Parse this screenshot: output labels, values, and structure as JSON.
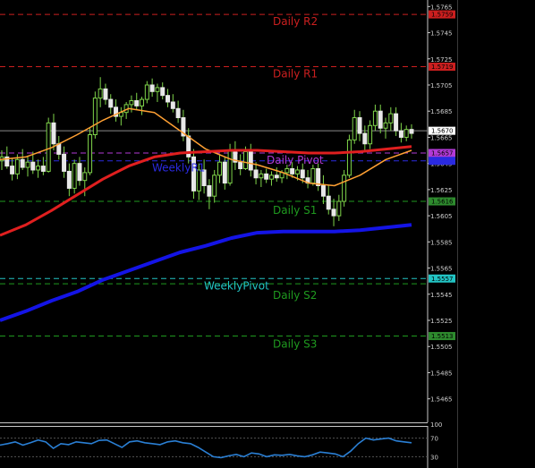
{
  "chart_data": {
    "type": "candlestick",
    "background": "#000000",
    "price_axis": {
      "ylim": [
        1.5447,
        1.577
      ],
      "ticks": [
        "1.5765",
        "1.5745",
        "1.5725",
        "1.5705",
        "1.5685",
        "1.5665",
        "1.5645",
        "1.5625",
        "1.5605",
        "1.5585",
        "1.5565",
        "1.5545",
        "1.5525",
        "1.5505",
        "1.5485",
        "1.5465"
      ],
      "tick_values": [
        1.5765,
        1.5745,
        1.5725,
        1.5705,
        1.5685,
        1.5665,
        1.5645,
        1.5625,
        1.5605,
        1.5585,
        1.5565,
        1.5545,
        1.5525,
        1.5505,
        1.5485,
        1.5465
      ]
    },
    "current_price": {
      "label": "1.5670",
      "value": 1.567
    },
    "levels": [
      {
        "name": "Daily R2",
        "value": 1.5759,
        "color": "#cc1f1f",
        "price_tag": "1.5759",
        "tag_bg": "#cc1f1f"
      },
      {
        "name": "Daily R1",
        "value": 1.5719,
        "color": "#cc1f1f",
        "price_tag": "1.5719",
        "tag_bg": "#cc1f1f"
      },
      {
        "name": "Daily Pivot",
        "value": 1.5653,
        "color": "#b23ad6",
        "price_tag": "1.5657",
        "tag_bg": "#b23ad6"
      },
      {
        "name": "WeeklyR1",
        "value": 1.5647,
        "color": "#2a2ae0",
        "price_tag": "",
        "tag_bg": "#2a2ae0"
      },
      {
        "name": "Daily S1",
        "value": 1.5616,
        "color": "#1f9a1f",
        "price_tag": "1.5616",
        "tag_bg": "#2e8b2e"
      },
      {
        "name": "WeeklyPivot",
        "value": 1.5557,
        "color": "#22c4c4",
        "price_tag": "1.5557",
        "tag_bg": "#22c4c4"
      },
      {
        "name": "Daily S2",
        "value": 1.5553,
        "color": "#1f9a1f",
        "price_tag": "",
        "tag_bg": "#2e8b2e"
      },
      {
        "name": "Daily S3",
        "value": 1.5513,
        "color": "#1f9a1f",
        "price_tag": "1.5513",
        "tag_bg": "#2e8b2e"
      }
    ],
    "candles": [
      [
        1.5647,
        1.5655,
        1.564,
        1.565
      ],
      [
        1.565,
        1.5658,
        1.5641,
        1.5643
      ],
      [
        1.5643,
        1.5649,
        1.5632,
        1.5637
      ],
      [
        1.5637,
        1.5652,
        1.5633,
        1.5648
      ],
      [
        1.5648,
        1.5656,
        1.564,
        1.5642
      ],
      [
        1.5642,
        1.5651,
        1.5635,
        1.5646
      ],
      [
        1.5646,
        1.5654,
        1.5637,
        1.564
      ],
      [
        1.564,
        1.5648,
        1.5634,
        1.5643
      ],
      [
        1.5643,
        1.565,
        1.5636,
        1.5639
      ],
      [
        1.5639,
        1.568,
        1.5638,
        1.5676
      ],
      [
        1.5676,
        1.5683,
        1.5655,
        1.566
      ],
      [
        1.566,
        1.5666,
        1.5648,
        1.5652
      ],
      [
        1.5652,
        1.5658,
        1.5634,
        1.5639
      ],
      [
        1.5639,
        1.5645,
        1.562,
        1.5626
      ],
      [
        1.5626,
        1.5648,
        1.5622,
        1.5645
      ],
      [
        1.5645,
        1.565,
        1.5628,
        1.5632
      ],
      [
        1.5632,
        1.5642,
        1.562,
        1.5638
      ],
      [
        1.5638,
        1.5672,
        1.5636,
        1.5667
      ],
      [
        1.5667,
        1.57,
        1.5664,
        1.5695
      ],
      [
        1.5695,
        1.5711,
        1.5688,
        1.5702
      ],
      [
        1.5702,
        1.5706,
        1.569,
        1.5694
      ],
      [
        1.5694,
        1.5698,
        1.5683,
        1.5688
      ],
      [
        1.5688,
        1.5694,
        1.5677,
        1.5681
      ],
      [
        1.5681,
        1.5688,
        1.5674,
        1.5684
      ],
      [
        1.5684,
        1.5692,
        1.5679,
        1.569
      ],
      [
        1.569,
        1.5697,
        1.5684,
        1.5693
      ],
      [
        1.5693,
        1.5699,
        1.5686,
        1.5689
      ],
      [
        1.5689,
        1.5696,
        1.5682,
        1.5694
      ],
      [
        1.5694,
        1.5708,
        1.5691,
        1.5705
      ],
      [
        1.5705,
        1.571,
        1.5696,
        1.57
      ],
      [
        1.57,
        1.5706,
        1.5692,
        1.5703
      ],
      [
        1.5703,
        1.5707,
        1.5694,
        1.5697
      ],
      [
        1.5697,
        1.5702,
        1.5688,
        1.5692
      ],
      [
        1.5692,
        1.5698,
        1.5684,
        1.5687
      ],
      [
        1.5687,
        1.5693,
        1.5676,
        1.568
      ],
      [
        1.568,
        1.5686,
        1.5662,
        1.5666
      ],
      [
        1.5666,
        1.5672,
        1.5645,
        1.565
      ],
      [
        1.565,
        1.5656,
        1.5618,
        1.5624
      ],
      [
        1.5624,
        1.5645,
        1.5617,
        1.564
      ],
      [
        1.564,
        1.5648,
        1.5622,
        1.5628
      ],
      [
        1.5628,
        1.5633,
        1.561,
        1.562
      ],
      [
        1.562,
        1.564,
        1.5615,
        1.5636
      ],
      [
        1.5636,
        1.5652,
        1.563,
        1.5646
      ],
      [
        1.5646,
        1.565,
        1.5625,
        1.563
      ],
      [
        1.563,
        1.566,
        1.5628,
        1.5655
      ],
      [
        1.5655,
        1.5662,
        1.564,
        1.5646
      ],
      [
        1.5646,
        1.5652,
        1.5636,
        1.5641
      ],
      [
        1.5641,
        1.5658,
        1.564,
        1.5654
      ],
      [
        1.5654,
        1.566,
        1.5635,
        1.564
      ],
      [
        1.564,
        1.5646,
        1.5629,
        1.5634
      ],
      [
        1.5634,
        1.564,
        1.5627,
        1.5637
      ],
      [
        1.5637,
        1.5641,
        1.563,
        1.5633
      ],
      [
        1.5633,
        1.5639,
        1.5628,
        1.5636
      ],
      [
        1.5636,
        1.5642,
        1.5631,
        1.5634
      ],
      [
        1.5634,
        1.564,
        1.563,
        1.5638
      ],
      [
        1.5638,
        1.5644,
        1.5633,
        1.5641
      ],
      [
        1.5641,
        1.5646,
        1.5634,
        1.5637
      ],
      [
        1.5637,
        1.5643,
        1.5632,
        1.564
      ],
      [
        1.564,
        1.5645,
        1.563,
        1.5634
      ],
      [
        1.5634,
        1.564,
        1.5626,
        1.563
      ],
      [
        1.563,
        1.5644,
        1.5628,
        1.5641
      ],
      [
        1.5641,
        1.5645,
        1.5624,
        1.5628
      ],
      [
        1.5628,
        1.5636,
        1.5614,
        1.562
      ],
      [
        1.562,
        1.5628,
        1.5606,
        1.561
      ],
      [
        1.561,
        1.5618,
        1.5597,
        1.5605
      ],
      [
        1.5605,
        1.5621,
        1.5601,
        1.5616
      ],
      [
        1.5616,
        1.564,
        1.5612,
        1.5636
      ],
      [
        1.5636,
        1.5667,
        1.5634,
        1.5663
      ],
      [
        1.5663,
        1.5686,
        1.566,
        1.568
      ],
      [
        1.568,
        1.5685,
        1.5662,
        1.5668
      ],
      [
        1.5668,
        1.5674,
        1.5655,
        1.566
      ],
      [
        1.566,
        1.5678,
        1.5656,
        1.5674
      ],
      [
        1.5674,
        1.569,
        1.567,
        1.5685
      ],
      [
        1.5685,
        1.569,
        1.5668,
        1.5672
      ],
      [
        1.5672,
        1.568,
        1.5664,
        1.5676
      ],
      [
        1.5676,
        1.5688,
        1.567,
        1.5683
      ],
      [
        1.5683,
        1.5688,
        1.5666,
        1.567
      ],
      [
        1.567,
        1.5676,
        1.5661,
        1.5665
      ],
      [
        1.5665,
        1.5674,
        1.5662,
        1.5671
      ],
      [
        1.5671,
        1.5675,
        1.5664,
        1.5668
      ]
    ],
    "moving_averages": [
      {
        "color": "#ffa033",
        "values": [
          1.5648,
          1.565,
          1.5657,
          1.5667,
          1.5678,
          1.5687,
          1.5684,
          1.567,
          1.5656,
          1.5648,
          1.5644,
          1.5638,
          1.563,
          1.5628,
          1.5636,
          1.5648,
          1.5655
        ]
      },
      {
        "color": "#e01f1f",
        "values": [
          1.559,
          1.5598,
          1.5609,
          1.5621,
          1.5633,
          1.5643,
          1.565,
          1.5653,
          1.5654,
          1.5655,
          1.5655,
          1.5654,
          1.5653,
          1.5653,
          1.5654,
          1.5656,
          1.5658
        ]
      },
      {
        "color": "#1414e6",
        "values": [
          1.5525,
          1.5532,
          1.554,
          1.5547,
          1.5556,
          1.5563,
          1.557,
          1.5577,
          1.5582,
          1.5588,
          1.5592,
          1.5593,
          1.5593,
          1.5593,
          1.5594,
          1.5596,
          1.5598
        ]
      }
    ],
    "oscillator": {
      "ylim": [
        0,
        100
      ],
      "ticks": [
        "100",
        "70",
        "30"
      ],
      "tick_values": [
        100,
        70,
        30
      ],
      "color": "#2a7fd4",
      "values": [
        55,
        58,
        62,
        55,
        60,
        66,
        62,
        48,
        58,
        56,
        62,
        60,
        58,
        65,
        66,
        58,
        50,
        62,
        64,
        60,
        58,
        56,
        62,
        64,
        60,
        58,
        50,
        40,
        30,
        28,
        32,
        35,
        30,
        38,
        36,
        30,
        34,
        33,
        35,
        32,
        30,
        34,
        40,
        38,
        36,
        30,
        42,
        58,
        70,
        66,
        68,
        70,
        64,
        62,
        60
      ]
    }
  }
}
